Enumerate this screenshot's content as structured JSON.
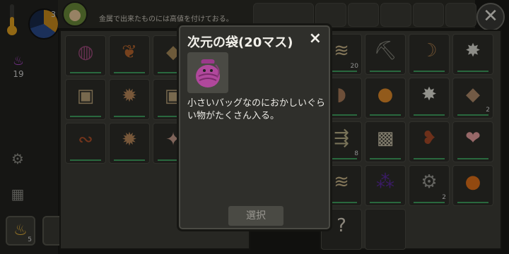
{
  "hud": {
    "clock_value": "3",
    "stat_icon": "flame-icon",
    "stat_value": "19",
    "quick_slot_count": "5"
  },
  "topbar": {
    "tip": "金属で出来たものには高値を付けておる。"
  },
  "modal": {
    "title": "次元の袋(20マス)",
    "close_label": "×",
    "description": "小さいバッグなのにおかしいぐらい物がたくさん入る。",
    "select_label": "選択",
    "item_icon": "purple-bag-icon"
  },
  "left_inventory": [
    {
      "icon": "bag-icon",
      "qty": ""
    },
    {
      "icon": "meat-icon",
      "qty": ""
    },
    {
      "icon": "ore-icon",
      "qty": ""
    },
    {
      "icon": "stone-block-icon",
      "qty": ""
    },
    {
      "icon": "fish-skeleton-icon",
      "qty": ""
    },
    {
      "icon": "stone-block-icon",
      "qty": ""
    },
    {
      "icon": "sausage-icon",
      "qty": ""
    },
    {
      "icon": "fish-skeleton-icon",
      "qty": ""
    },
    {
      "icon": "bone-icon",
      "qty": ""
    }
  ],
  "right_inventory": [
    {
      "icon": "fiber-bundle-icon",
      "qty": "20"
    },
    {
      "icon": "pickaxe-icon",
      "qty": ""
    },
    {
      "icon": "bow-icon",
      "qty": ""
    },
    {
      "icon": "fish-skeleton-icon",
      "qty": ""
    },
    {
      "icon": "hide-icon",
      "qty": ""
    },
    {
      "icon": "amber-icon",
      "qty": ""
    },
    {
      "icon": "bird-skeleton-icon",
      "qty": ""
    },
    {
      "icon": "leather-icon",
      "qty": "2"
    },
    {
      "icon": "arrows-icon",
      "qty": "8"
    },
    {
      "icon": "cloth-armor-icon",
      "qty": ""
    },
    {
      "icon": "meat-drumstick-icon",
      "qty": ""
    },
    {
      "icon": "ham-icon",
      "qty": ""
    },
    {
      "icon": "fiber-bundle-icon",
      "qty": ""
    },
    {
      "icon": "berries-icon",
      "qty": ""
    },
    {
      "icon": "gear-icon",
      "qty": "2"
    },
    {
      "icon": "pumpkin-icon",
      "qty": ""
    },
    {
      "icon": "unknown-recipe-icon",
      "qty": ""
    },
    {
      "icon": "empty-slot",
      "qty": ""
    }
  ]
}
